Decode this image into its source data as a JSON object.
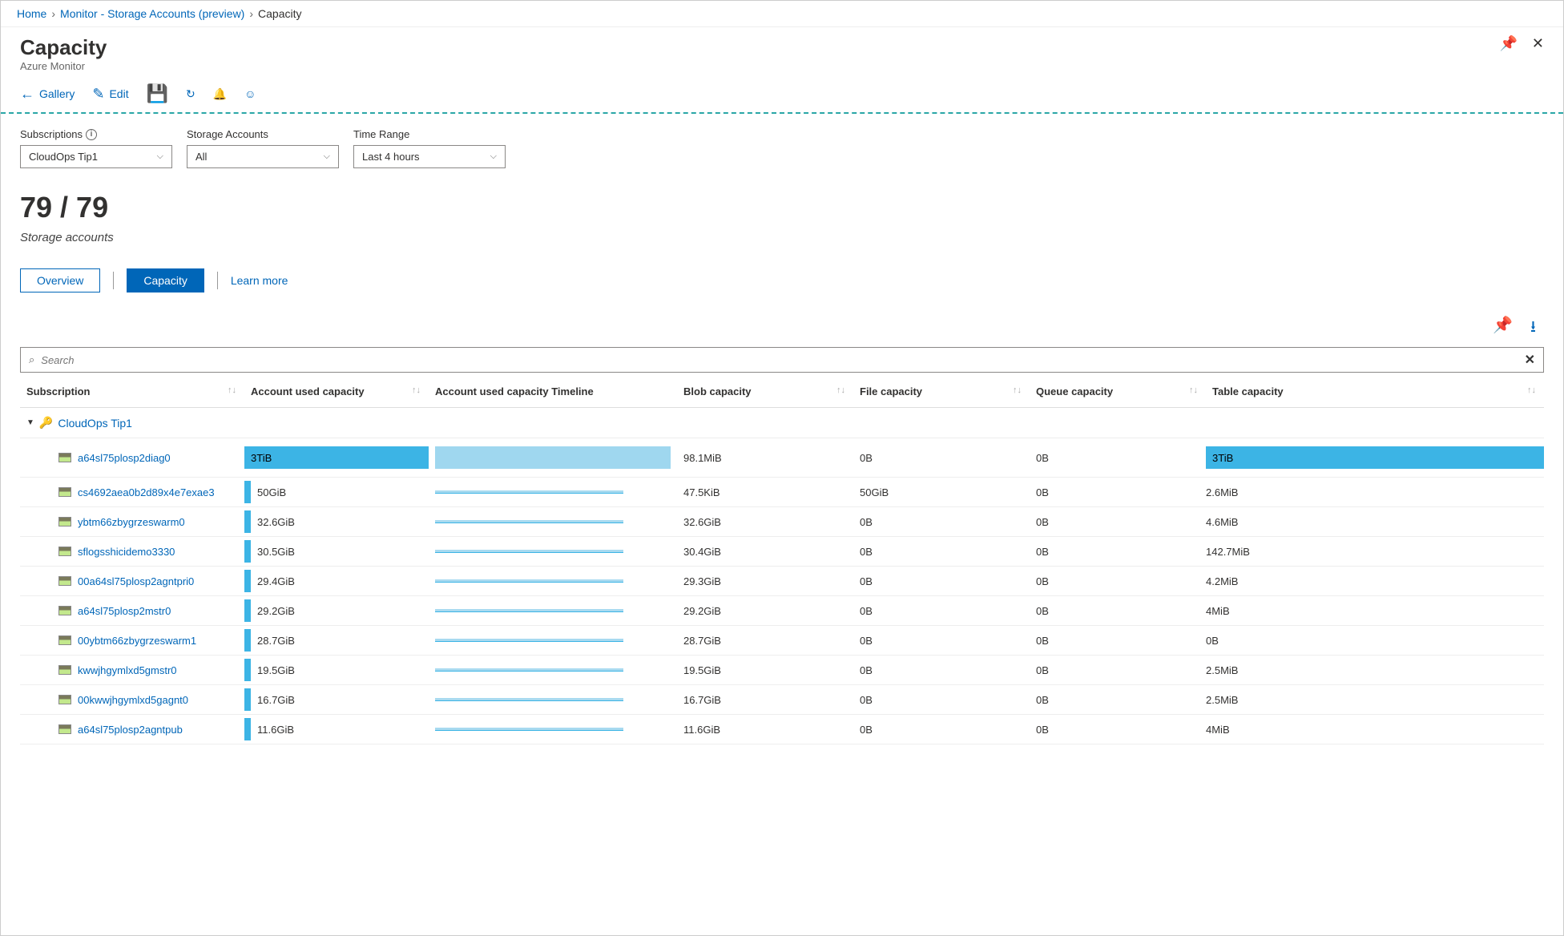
{
  "breadcrumb": {
    "home": "Home",
    "monitor": "Monitor - Storage Accounts (preview)",
    "current": "Capacity"
  },
  "header": {
    "title": "Capacity",
    "subtitle": "Azure Monitor"
  },
  "toolbar": {
    "gallery": "Gallery",
    "edit": "Edit"
  },
  "filters": {
    "subscriptions": {
      "label": "Subscriptions",
      "value": "CloudOps Tip1"
    },
    "storage_accounts": {
      "label": "Storage Accounts",
      "value": "All"
    },
    "time_range": {
      "label": "Time Range",
      "value": "Last 4 hours"
    }
  },
  "count": {
    "value": "79 / 79",
    "caption": "Storage accounts"
  },
  "tabs": {
    "overview": "Overview",
    "capacity": "Capacity",
    "learn_more": "Learn more"
  },
  "search": {
    "placeholder": "Search"
  },
  "columns": {
    "subscription": "Subscription",
    "account_used": "Account used capacity",
    "timeline": "Account used capacity Timeline",
    "blob": "Blob capacity",
    "file": "File capacity",
    "queue": "Queue capacity",
    "table": "Table capacity"
  },
  "group": {
    "name": "CloudOps Tip1"
  },
  "rows": [
    {
      "name": "a64sl75plosp2diag0",
      "used": "3TiB",
      "bar_pct": 100,
      "timeline_pct": 100,
      "blob": "98.1MiB",
      "file": "0B",
      "queue": "0B",
      "table": "3TiB",
      "table_bar_pct": 100
    },
    {
      "name": "cs4692aea0b2d89x4e7exae3",
      "used": "50GiB",
      "bar_pct": 2,
      "timeline_pct": 80,
      "blob": "47.5KiB",
      "file": "50GiB",
      "queue": "0B",
      "table": "2.6MiB",
      "table_bar_pct": 0
    },
    {
      "name": "ybtm66zbygrzeswarm0",
      "used": "32.6GiB",
      "bar_pct": 1,
      "timeline_pct": 80,
      "blob": "32.6GiB",
      "file": "0B",
      "queue": "0B",
      "table": "4.6MiB",
      "table_bar_pct": 0
    },
    {
      "name": "sflogsshicidemo3330",
      "used": "30.5GiB",
      "bar_pct": 1,
      "timeline_pct": 80,
      "blob": "30.4GiB",
      "file": "0B",
      "queue": "0B",
      "table": "142.7MiB",
      "table_bar_pct": 0
    },
    {
      "name": "00a64sl75plosp2agntpri0",
      "used": "29.4GiB",
      "bar_pct": 1,
      "timeline_pct": 80,
      "blob": "29.3GiB",
      "file": "0B",
      "queue": "0B",
      "table": "4.2MiB",
      "table_bar_pct": 0
    },
    {
      "name": "a64sl75plosp2mstr0",
      "used": "29.2GiB",
      "bar_pct": 1,
      "timeline_pct": 80,
      "blob": "29.2GiB",
      "file": "0B",
      "queue": "0B",
      "table": "4MiB",
      "table_bar_pct": 0
    },
    {
      "name": "00ybtm66zbygrzeswarm1",
      "used": "28.7GiB",
      "bar_pct": 1,
      "timeline_pct": 80,
      "blob": "28.7GiB",
      "file": "0B",
      "queue": "0B",
      "table": "0B",
      "table_bar_pct": 0
    },
    {
      "name": "kwwjhgymlxd5gmstr0",
      "used": "19.5GiB",
      "bar_pct": 1,
      "timeline_pct": 80,
      "blob": "19.5GiB",
      "file": "0B",
      "queue": "0B",
      "table": "2.5MiB",
      "table_bar_pct": 0
    },
    {
      "name": "00kwwjhgymlxd5gagnt0",
      "used": "16.7GiB",
      "bar_pct": 1,
      "timeline_pct": 80,
      "blob": "16.7GiB",
      "file": "0B",
      "queue": "0B",
      "table": "2.5MiB",
      "table_bar_pct": 0
    },
    {
      "name": "a64sl75plosp2agntpub",
      "used": "11.6GiB",
      "bar_pct": 0,
      "timeline_pct": 80,
      "blob": "11.6GiB",
      "file": "0B",
      "queue": "0B",
      "table": "4MiB",
      "table_bar_pct": 0
    }
  ]
}
